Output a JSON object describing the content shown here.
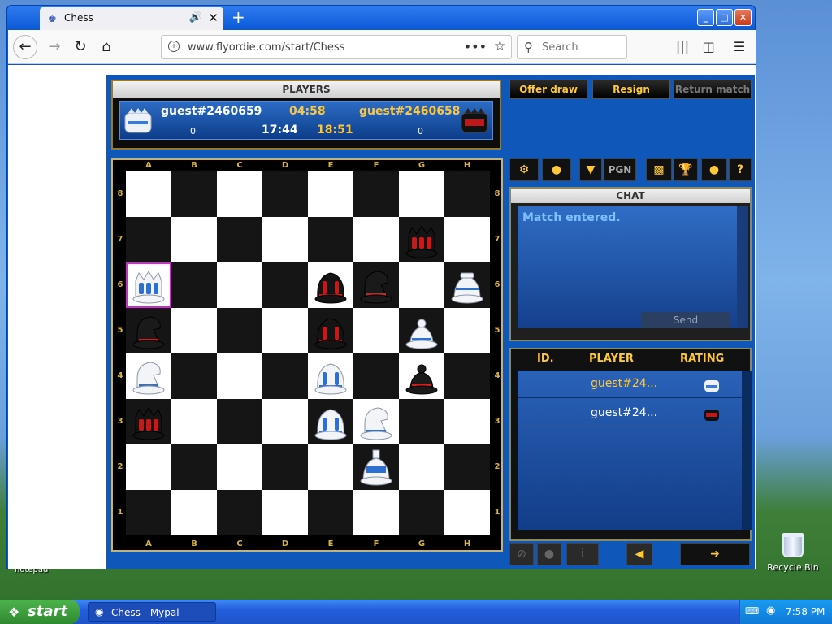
{
  "browser": {
    "tab_title": "Chess",
    "tab_icon": "chess-favicon",
    "url": "www.flyordie.com/start/Chess",
    "search_placeholder": "Search"
  },
  "players_panel": {
    "title": "PLAYERS",
    "left_player": "guest#2460659",
    "left_score": "0",
    "right_player": "guest#2460658",
    "right_score": "0",
    "move_time": "04:58",
    "left_clock": "17:44",
    "right_clock": "18:51"
  },
  "buttons": {
    "offer_draw": "Offer draw",
    "resign": "Resign",
    "return_match": "Return match",
    "pgn": "PGN"
  },
  "board": {
    "files": [
      "A",
      "B",
      "C",
      "D",
      "E",
      "F",
      "G",
      "H"
    ],
    "ranks": [
      "8",
      "7",
      "6",
      "5",
      "4",
      "3",
      "2",
      "1"
    ],
    "highlight_square": "a6",
    "pieces": [
      {
        "square": "g7",
        "color": "red",
        "type": "queen"
      },
      {
        "square": "a6",
        "color": "white",
        "type": "queen"
      },
      {
        "square": "e6",
        "color": "red",
        "type": "rook"
      },
      {
        "square": "f6",
        "color": "black",
        "type": "knight"
      },
      {
        "square": "h6",
        "color": "white",
        "type": "bishop"
      },
      {
        "square": "a5",
        "color": "black",
        "type": "knight"
      },
      {
        "square": "e5",
        "color": "red",
        "type": "rook"
      },
      {
        "square": "g5",
        "color": "white",
        "type": "pawn"
      },
      {
        "square": "a4",
        "color": "white",
        "type": "knight"
      },
      {
        "square": "e4",
        "color": "white",
        "type": "rook"
      },
      {
        "square": "g4",
        "color": "black",
        "type": "pawn"
      },
      {
        "square": "a3",
        "color": "red",
        "type": "queen"
      },
      {
        "square": "e3",
        "color": "white",
        "type": "rook"
      },
      {
        "square": "f3",
        "color": "white",
        "type": "knight"
      },
      {
        "square": "f2",
        "color": "white",
        "type": "king"
      }
    ]
  },
  "chat": {
    "title": "CHAT",
    "message": "Match entered.",
    "send_label": "Send"
  },
  "player_list": {
    "headers": [
      "ID.",
      "PLAYER",
      "RATING"
    ],
    "rows": [
      {
        "name": "guest#24...",
        "color": "#ffc83a",
        "side": "white"
      },
      {
        "name": "guest#24...",
        "color": "#ffffff",
        "side": "red"
      }
    ]
  },
  "desktop": {
    "recycle_bin": "Recycle Bin",
    "notepad": "notepad"
  },
  "taskbar": {
    "start": "start",
    "window_item": "Chess - Mypal",
    "clock": "7:58 PM"
  },
  "colors": {
    "accent_gold": "#ffc83a",
    "board_light": "#ffffff",
    "board_dark": "#151515",
    "game_bg": "#0f57b8"
  }
}
